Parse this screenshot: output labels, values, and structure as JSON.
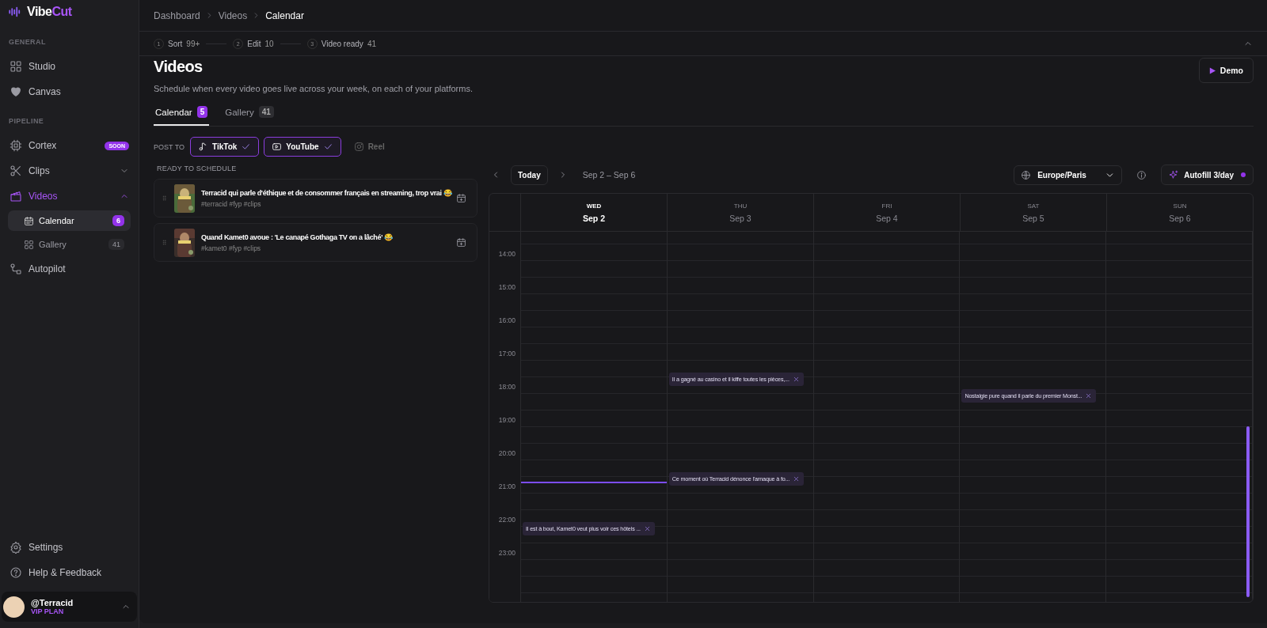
{
  "brand": {
    "name_a": "Vibe",
    "name_b": "Cut"
  },
  "sidebar": {
    "sections": [
      {
        "label": "GENERAL",
        "items": [
          {
            "label": "Studio",
            "selected": false
          },
          {
            "label": "Canvas",
            "selected": false
          }
        ]
      },
      {
        "label": "PIPELINE",
        "items": [
          {
            "label": "Cortex",
            "selected": false,
            "badge": "SOON"
          },
          {
            "label": "Clips",
            "selected": false,
            "expanded": false
          },
          {
            "label": "Videos",
            "selected": true,
            "expanded": true,
            "children": [
              {
                "label": "Calendar",
                "selected": true,
                "count": "6"
              },
              {
                "label": "Gallery",
                "selected": false,
                "count": "41"
              }
            ]
          },
          {
            "label": "Autopilot",
            "selected": false
          }
        ]
      }
    ],
    "footer_items": [
      {
        "label": "Settings"
      },
      {
        "label": "Help & Feedback"
      }
    ],
    "user": {
      "handle": "@Terracid",
      "plan": "VIP PLAN"
    }
  },
  "breadcrumb": [
    "Dashboard",
    "Videos",
    "Calendar"
  ],
  "steps": [
    {
      "number": "1",
      "label": "Sort",
      "count": "99+"
    },
    {
      "number": "2",
      "label": "Edit",
      "count": "10"
    },
    {
      "number": "3",
      "label": "Video ready",
      "count": "41"
    }
  ],
  "page": {
    "title": "Videos",
    "subtitle": "Schedule when every video goes live across your week, on each of your platforms.",
    "demo_button": "Demo"
  },
  "tabs": [
    {
      "label": "Calendar",
      "count": "5",
      "selected": true
    },
    {
      "label": "Gallery",
      "count": "41",
      "selected": false
    }
  ],
  "post_to": {
    "label": "POST TO",
    "platforms": [
      {
        "label": "TikTok",
        "checked": true
      },
      {
        "label": "YouTube",
        "checked": true
      },
      {
        "label": "Reel",
        "checked": false
      }
    ]
  },
  "queue": {
    "title": "READY TO SCHEDULE",
    "items": [
      {
        "title": "Terracid qui parle d'éthique et de consommer français en streaming, trop vrai 😂",
        "tags": "#terracid #fyp #clips"
      },
      {
        "title": "Quand Kamet0 avoue : 'Le canapé Gothaga TV on a lâché' 😂",
        "tags": "#kamet0 #fyp #clips"
      }
    ]
  },
  "calendar": {
    "today_button": "Today",
    "range": "Sep 2 – Sep 6",
    "timezone": "Europe/Paris",
    "autofill": "Autofill 3/day",
    "days": [
      {
        "weekday": "WED",
        "date": "Sep 2",
        "selected": true
      },
      {
        "weekday": "THU",
        "date": "Sep 3",
        "selected": false
      },
      {
        "weekday": "FRI",
        "date": "Sep 4",
        "selected": false
      },
      {
        "weekday": "SAT",
        "date": "Sep 5",
        "selected": false
      },
      {
        "weekday": "SUN",
        "date": "Sep 6",
        "selected": false
      }
    ],
    "hours": [
      {
        "label": "14:00"
      },
      {
        "label": "15:00"
      },
      {
        "label": "16:00"
      },
      {
        "label": "17:00",
        "second_half": {
          "thu": {
            "title": "Il a gagné au casino et il kiffe toutes les pièces,..."
          }
        }
      },
      {
        "label": "18:00",
        "first_half": {
          "sat": {
            "title": "Nostalgie pure quand il parle du premier Monst..."
          }
        }
      },
      {
        "label": "19:00"
      },
      {
        "label": "20:00",
        "second_half": {
          "thu": {
            "title": "Ce moment où Terracid dénonce l'arnaque à fo..."
          }
        }
      },
      {
        "label": "21:00"
      },
      {
        "label": "22:00",
        "first_half": {
          "wed": {
            "title": "Il est à bout, Kamet0 veut plus voir ces hôtels ..."
          }
        }
      },
      {
        "label": "23:00"
      }
    ]
  }
}
